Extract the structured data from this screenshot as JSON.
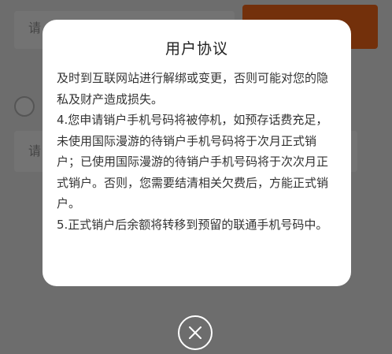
{
  "background": {
    "top_input_placeholder": "请",
    "mid_input_placeholder": "请"
  },
  "modal": {
    "title": "用户协议",
    "paragraphs": [
      "及时到互联网站进行解绑或变更，否则可能对您的隐私及财产造成损失。",
      "4.您申请销户手机号码将被停机，如预存话费充足，未使用国际漫游的待销户手机号码将于次月正式销户；已使用国际漫游的待销户手机号码将于次次月正式销户。否则，您需要结清相关欠费后，方能正式销户。",
      "5.正式销户后余额将转移到预留的联通手机号码中。"
    ]
  },
  "close_button": {
    "icon": "close-icon"
  },
  "colors": {
    "accent": "#ff6a1a",
    "overlay": "rgba(0,0,0,0.55)"
  }
}
